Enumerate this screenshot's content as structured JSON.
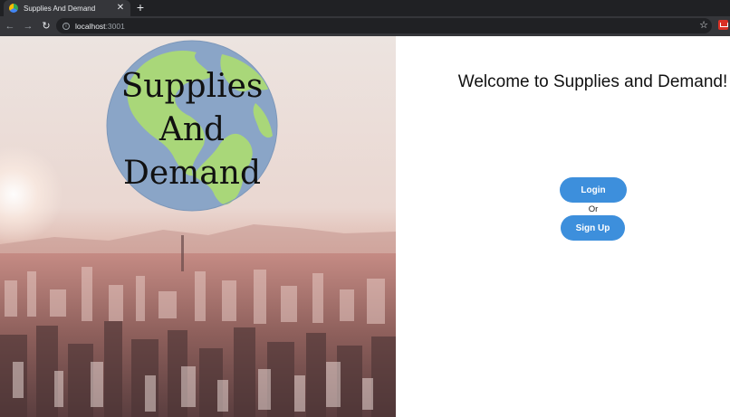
{
  "browser": {
    "tab_title": "Supplies And Demand",
    "tab_close": "✕",
    "new_tab": "+",
    "back": "←",
    "forward": "→",
    "reload": "↻",
    "url_host": "localhost",
    "url_port": ":3001",
    "info": "i",
    "bookmark": "☆"
  },
  "hero": {
    "logo_line1": "Supplies",
    "logo_line2": "And",
    "logo_line3": "Demand"
  },
  "main": {
    "welcome": "Welcome to Supplies and Demand!",
    "login_label": "Login",
    "or_label": "Or",
    "signup_label": "Sign Up"
  },
  "colors": {
    "button": "#3d8fdc",
    "globe_ocean": "#8aa5c7",
    "globe_land": "#a9d779"
  }
}
